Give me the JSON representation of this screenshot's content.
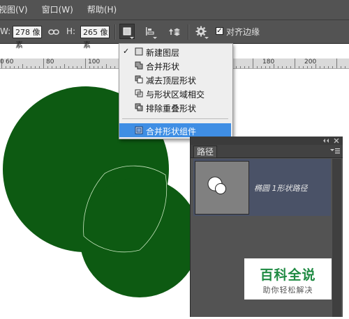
{
  "menu": {
    "items": [
      "视图(V)",
      "窗口(W)",
      "帮助(H)"
    ]
  },
  "options": {
    "w_label": "W:",
    "w_value": "278 像素",
    "h_label": "H:",
    "h_value": "265 像素",
    "align_edges_label": "对齐边缘",
    "align_edges_checked": true
  },
  "ruler": {
    "labels": [
      "0",
      "60",
      "80",
      "100",
      "180",
      "200"
    ]
  },
  "dropdown": {
    "items": [
      {
        "label": "新建图层",
        "checked": true,
        "highlighted": false
      },
      {
        "label": "合并形状",
        "checked": false,
        "highlighted": false
      },
      {
        "label": "减去顶层形状",
        "checked": false,
        "highlighted": false
      },
      {
        "label": "与形状区域相交",
        "checked": false,
        "highlighted": false
      },
      {
        "label": "排除重叠形状",
        "checked": false,
        "highlighted": false
      },
      {
        "label": "合并形状组件",
        "checked": false,
        "highlighted": true
      }
    ]
  },
  "panel": {
    "tab": "路径",
    "path_name": "椭圆 1形状路径"
  },
  "shapes": {
    "fill_color": "#0d5a12"
  },
  "watermark": {
    "title": "百科全说",
    "subtitle": "助你轻松解决"
  },
  "colors": {
    "ui_bg": "#535353",
    "highlight": "#3f8ee4"
  }
}
